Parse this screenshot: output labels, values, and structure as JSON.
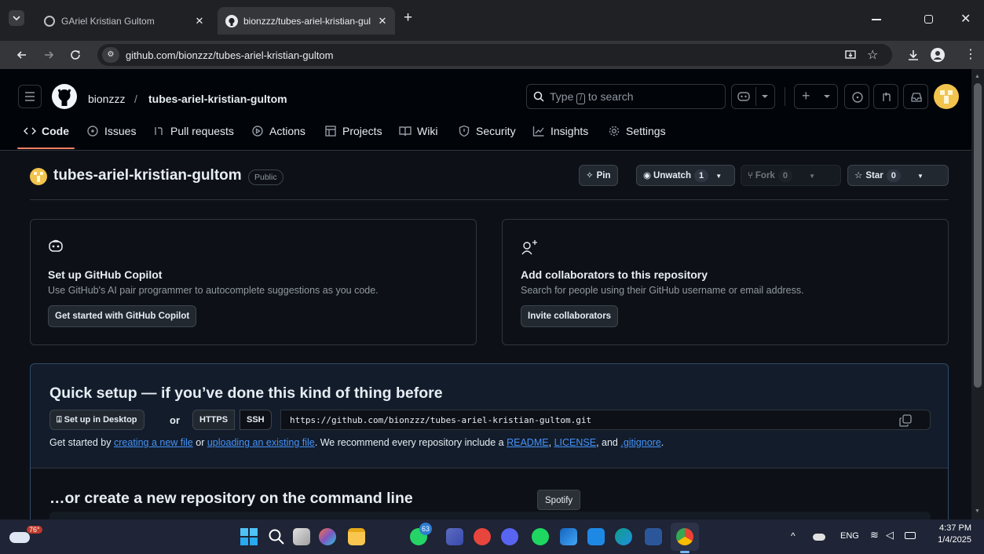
{
  "browser": {
    "tabs": [
      {
        "title": "GAriel Kristian Gultom",
        "active": false
      },
      {
        "title": "bionzzz/tubes-ariel-kristian-gul",
        "active": true
      }
    ],
    "new_tab_glyph": "+",
    "url": "github.com/bionzzz/tubes-ariel-kristian-gultom",
    "window_controls": [
      "minimize",
      "restore",
      "close"
    ]
  },
  "github": {
    "owner": "bionzzz",
    "separator": "/",
    "repo": "tubes-ariel-kristian-gultom",
    "search": {
      "prefix": "Type",
      "key": "/",
      "suffix": "to search"
    },
    "nav_tabs": [
      {
        "label": "Code",
        "icon": "code-icon",
        "active": true
      },
      {
        "label": "Issues",
        "icon": "issue-icon"
      },
      {
        "label": "Pull requests",
        "icon": "pull-request-icon"
      },
      {
        "label": "Actions",
        "icon": "play-icon"
      },
      {
        "label": "Projects",
        "icon": "table-icon"
      },
      {
        "label": "Wiki",
        "icon": "book-icon"
      },
      {
        "label": "Security",
        "icon": "shield-icon"
      },
      {
        "label": "Insights",
        "icon": "graph-icon"
      },
      {
        "label": "Settings",
        "icon": "gear-icon"
      }
    ],
    "repo_title": "tubes-ariel-kristian-gultom",
    "visibility": "Public",
    "actions": {
      "pin": "Pin",
      "unwatch": "Unwatch",
      "watch_count": "1",
      "fork": "Fork",
      "fork_count": "0",
      "star": "Star",
      "star_count": "0"
    },
    "copilot_card": {
      "title": "Set up GitHub Copilot",
      "description": "Use GitHub's AI pair programmer to autocomplete suggestions as you code.",
      "button": "Get started with GitHub Copilot"
    },
    "collab_card": {
      "title": "Add collaborators to this repository",
      "description": "Search for people using their GitHub username or email address.",
      "button": "Invite collaborators"
    },
    "quick_setup": {
      "title": "Quick setup — if you’ve done this kind of thing before",
      "desktop_button": "Set up in Desktop",
      "or": "or",
      "https": "HTTPS",
      "ssh": "SSH",
      "clone_url": "https://github.com/bionzzz/tubes-ariel-kristian-gultom.git",
      "help_prefix": "Get started by",
      "link_new_file": "creating a new file",
      "help_or": "or",
      "link_upload": "uploading an existing file",
      "help_mid": ". We recommend every repository include a",
      "link_readme": "README",
      "comma": ",",
      "link_license": "LICENSE",
      "and": ", and",
      "link_gitignore": ".gitignore",
      "period": "."
    },
    "cmdline_title": "…or create a new repository on the command line",
    "tooltip": "Spotify"
  },
  "taskbar": {
    "weather": "76°",
    "edge_badge": "63",
    "language": "ENG",
    "time": "4:37 PM",
    "date": "1/4/2025"
  },
  "colors": {
    "accent": "#4493f8",
    "bg": "#0d1117",
    "header_bg": "#010409",
    "border": "#30363d",
    "quick_setup_bg": "#131c2b",
    "tab_underline": "#f78166"
  }
}
